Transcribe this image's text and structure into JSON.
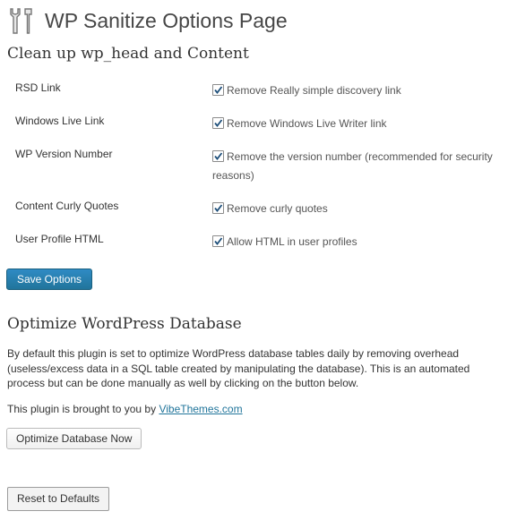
{
  "header": {
    "title": "WP Sanitize Options Page",
    "icon": "tools-icon"
  },
  "section_cleanup": {
    "title": "Clean up wp_head and Content",
    "options": [
      {
        "label": "RSD Link",
        "description": "Remove Really simple discovery link",
        "checked": true
      },
      {
        "label": "Windows Live Link",
        "description": "Remove Windows Live Writer link",
        "checked": true
      },
      {
        "label": "WP Version Number",
        "description": "Remove the version number (recommended for security reasons)",
        "checked": true
      },
      {
        "label": "Content Curly Quotes",
        "description": "Remove curly quotes",
        "checked": true
      },
      {
        "label": "User Profile HTML",
        "description": "Allow HTML in user profiles",
        "checked": true
      }
    ],
    "save_button": "Save Options"
  },
  "section_optimize": {
    "title": "Optimize WordPress Database",
    "description": "By default this plugin is set to optimize WordPress database tables daily by removing overhead (useless/excess data in a SQL table created by manipulating the database). This is an automated process but can be done manually as well by clicking on the button below.",
    "credit_prefix": "This plugin is brought to you by ",
    "credit_link": "VibeThemes.com",
    "optimize_button": "Optimize Database Now"
  },
  "reset_button": "Reset to Defaults",
  "colors": {
    "primary_button": "#21759b",
    "link": "#21759b",
    "text": "#333333"
  }
}
